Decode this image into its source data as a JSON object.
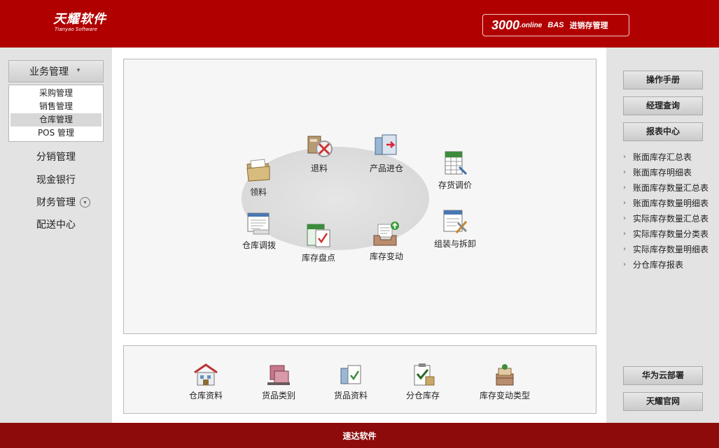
{
  "header": {
    "brand_cn": "天耀软件",
    "brand_en": "Tianyao Software",
    "product_num": "3000",
    "product_online": ".online",
    "product_bas": "BAS",
    "product_desc": "进销存管理"
  },
  "left_menu": {
    "head_label": "业务管理",
    "submenu": [
      "采购管理",
      "销售管理",
      "仓库管理",
      "POS 管理"
    ],
    "active_index": 2,
    "items": [
      "分销管理",
      "现金银行",
      "财务管理",
      "配送中心"
    ]
  },
  "workflow": {
    "tiles": {
      "receive": "领料",
      "return": "退料",
      "product_in": "产品进仓",
      "price_adjust": "存货调价",
      "transfer": "仓库调拨",
      "stocktake": "库存盘点",
      "stock_change": "库存变动",
      "assembly": "组装与拆卸"
    }
  },
  "bottom_tiles": [
    "仓库资料",
    "货品类别",
    "货品资料",
    "分仓库存",
    "库存变动类型"
  ],
  "right_panel": {
    "manual": "操作手册",
    "manager_query": "经理查询",
    "report_center": "报表中心",
    "reports": [
      "账面库存汇总表",
      "账面库存明细表",
      "账面库存数量汇总表",
      "账面库存数量明细表",
      "实际库存数量汇总表",
      "实际库存数量分类表",
      "实际库存数量明细表",
      "分仓库存报表"
    ],
    "huawei": "华为云部署",
    "official": "天耀官网"
  },
  "footer": {
    "text": "速达软件"
  },
  "colors": {
    "header_red": "#b10000",
    "footer_red": "#8e0b0b"
  },
  "icons": {
    "chevron": "double-chevron-down-icon",
    "arrow": "chevron-right-icon"
  }
}
